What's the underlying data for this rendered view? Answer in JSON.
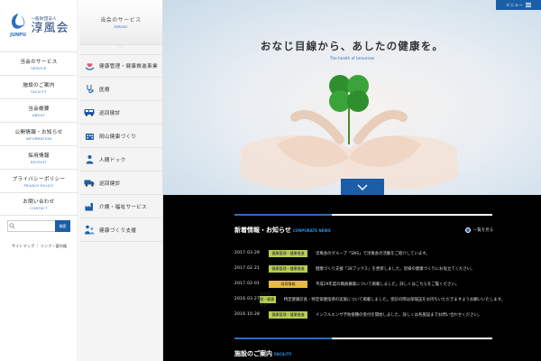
{
  "logo": {
    "sub": "一般財団法人",
    "main": "淳風会",
    "mark_text": "JUNPU"
  },
  "nav": [
    {
      "jp": "当会のサービス",
      "en": "SERVICE"
    },
    {
      "jp": "施設のご案内",
      "en": "FACILITY"
    },
    {
      "jp": "当会概要",
      "en": "ABOUT"
    },
    {
      "jp": "公開情報・お知らせ",
      "en": "INFORMATION"
    },
    {
      "jp": "採用情報",
      "en": "RECRUIT"
    },
    {
      "jp": "プライバシーポリシー",
      "en": "PRIVACY POLICY"
    },
    {
      "jp": "お問い合わせ",
      "en": "CONTACT"
    }
  ],
  "search": {
    "placeholder": "",
    "button": "検索"
  },
  "footer_links": "サイトマップ ｜ リンク・著作権",
  "service": {
    "heading_jp": "当会のサービス",
    "heading_en": "SERVICE",
    "items": [
      {
        "label": "健康管理・健康推進事業",
        "icon": "heart-hands-icon"
      },
      {
        "label": "医療",
        "icon": "stethoscope-icon"
      },
      {
        "label": "巡回健診",
        "icon": "bus-icon"
      },
      {
        "label": "岡山健康づくり",
        "icon": "building-icon"
      },
      {
        "label": "人間ドック",
        "icon": "person-icon"
      },
      {
        "label": "巡回健診",
        "icon": "truck-icon"
      },
      {
        "label": "介護・福祉サービス",
        "icon": "factory-icon"
      },
      {
        "label": "健康づくり支援",
        "icon": "caregiver-icon"
      }
    ]
  },
  "topmenu": {
    "label": "メニュー"
  },
  "hero": {
    "title": "おなじ目線から、あしたの健康を。",
    "subtitle": "The health of tomorrow"
  },
  "news": {
    "title": "新着情報・お知らせ",
    "title_en": "CORPORATE NEWS",
    "more": "一覧を見る",
    "items": [
      {
        "date": "2017.03.29",
        "category": "健康管理・健康推進",
        "color": "#b6cf52",
        "text": "淳風会のグループ「SNS」で淳風会の活動をご紹介しています。"
      },
      {
        "date": "2017.02.21",
        "category": "健康管理・健康推進",
        "color": "#b6cf52",
        "text": "健康づくり支援「28ブックス」を更新しました。皆様の健康づくりにお役立てください。"
      },
      {
        "date": "2017.02.01",
        "category": "採用情報",
        "color": "#e8b84a",
        "text": "平成29年度の職員募集について掲載しました。詳しくはこちらをご覧ください。"
      },
      {
        "date": "2016.03.27",
        "category": "健康管理・健康推進",
        "color": "#b6cf52",
        "text": "特定健康診査・特定保健指導の実施について掲載しました。受診の際は保険証をお持ちいただきますようお願いいたします。"
      },
      {
        "date": "2016.10.28",
        "category": "健康管理・健康推進",
        "color": "#b6cf52",
        "text": "インフルエンザ予防接種の受付を開始しました。詳しくは各施設までお問い合わせください。"
      }
    ]
  },
  "section2": {
    "title": "施設のご案内",
    "title_en": "FACILITY"
  }
}
